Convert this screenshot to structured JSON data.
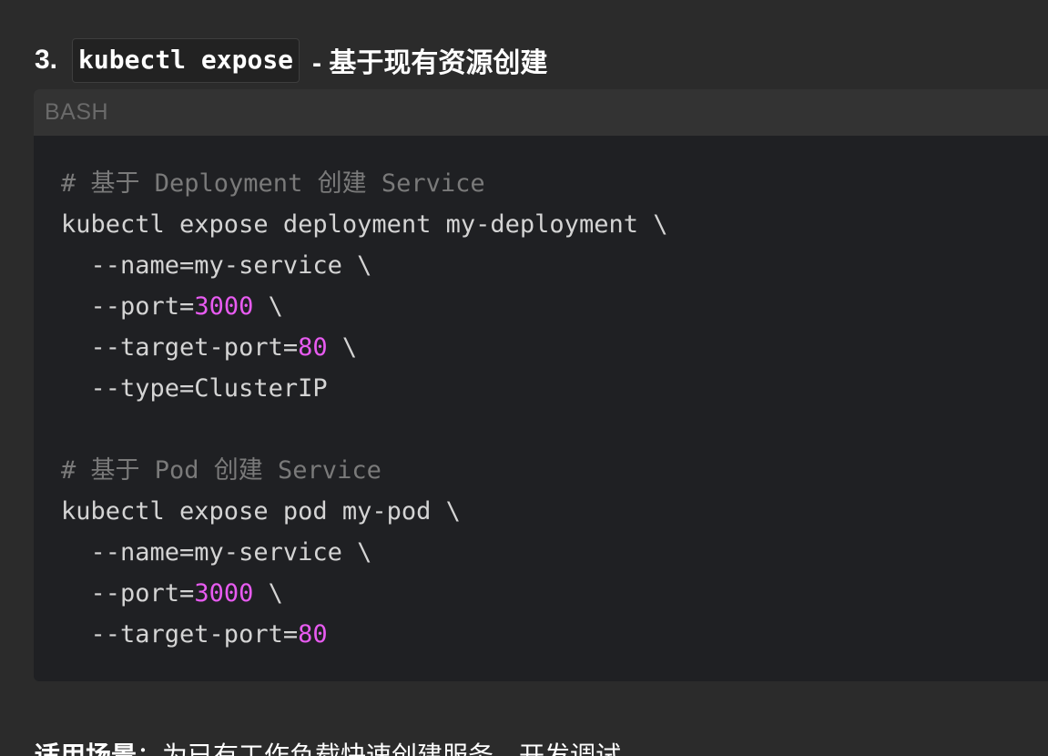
{
  "heading": {
    "number": "3.",
    "command": "kubectl expose",
    "rest": "- 基于现有资源创建"
  },
  "code_block": {
    "language": "BASH",
    "lines": [
      [
        {
          "type": "comment",
          "text": "# 基于 Deployment 创建 Service"
        }
      ],
      [
        {
          "type": "plain",
          "text": "kubectl expose deployment my-deployment \\"
        }
      ],
      [
        {
          "type": "plain",
          "text": "  --name=my-service \\"
        }
      ],
      [
        {
          "type": "plain",
          "text": "  --port="
        },
        {
          "type": "number",
          "text": "3000"
        },
        {
          "type": "plain",
          "text": " \\"
        }
      ],
      [
        {
          "type": "plain",
          "text": "  --target-port="
        },
        {
          "type": "number",
          "text": "80"
        },
        {
          "type": "plain",
          "text": " \\"
        }
      ],
      [
        {
          "type": "plain",
          "text": "  --type=ClusterIP"
        }
      ],
      [],
      [
        {
          "type": "comment",
          "text": "# 基于 Pod 创建 Service"
        }
      ],
      [
        {
          "type": "plain",
          "text": "kubectl expose pod my-pod \\"
        }
      ],
      [
        {
          "type": "plain",
          "text": "  --name=my-service \\"
        }
      ],
      [
        {
          "type": "plain",
          "text": "  --port="
        },
        {
          "type": "number",
          "text": "3000"
        },
        {
          "type": "plain",
          "text": " \\"
        }
      ],
      [
        {
          "type": "plain",
          "text": "  --target-port="
        },
        {
          "type": "number",
          "text": "80"
        }
      ]
    ]
  },
  "footer": {
    "label": "适用场景",
    "text": "：为已有工作负载快速创建服务、开发调试"
  },
  "colors": {
    "background": "#2b2b2b",
    "code_background": "#1f2023",
    "code_header": "#333333",
    "comment": "#7a7a7a",
    "number": "#e75bf0",
    "text": "#d4d4d4"
  }
}
